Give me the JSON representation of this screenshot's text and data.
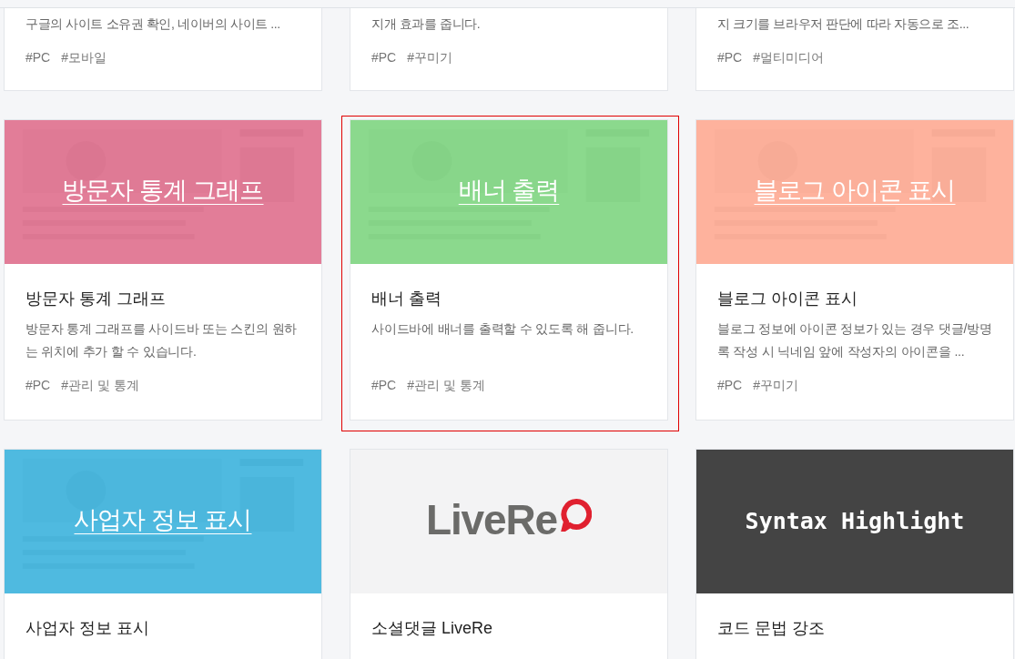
{
  "partial_cards": [
    {
      "description": "구글의 사이트 소유권 확인, 네이버의 사이트 ...",
      "tags": [
        "#PC",
        "#모바일"
      ]
    },
    {
      "description": "지개 효과를 줍니다.",
      "tags": [
        "#PC",
        "#꾸미기"
      ]
    },
    {
      "description": "지 크기를 브라우저 판단에 따라 자동으로 조...",
      "tags": [
        "#PC",
        "#멀티미디어"
      ]
    }
  ],
  "cards": [
    {
      "thumbnail": {
        "kind": "picture",
        "color": "#e0708e",
        "caption": "방문자 통계 그래프"
      },
      "title": "방문자 통계 그래프",
      "description": "방문자 통계 그래프를 사이드바 또는 스킨의 원하는 위치에 추가 할 수 있습니다.",
      "tags": [
        "#PC",
        "#관리 및 통계"
      ],
      "selected": false
    },
    {
      "thumbnail": {
        "kind": "picture",
        "color": "#80d682",
        "caption": "배너 출력"
      },
      "title": "배너 출력",
      "description": "사이드바에 배너를 출력할 수 있도록 해 줍니다.",
      "tags": [
        "#PC",
        "#관리 및 통계"
      ],
      "selected": true
    },
    {
      "thumbnail": {
        "kind": "picture",
        "color": "#ffab94",
        "caption": "블로그 아이콘 표시"
      },
      "title": "블로그 아이콘 표시",
      "description": "블로그 정보에 아이콘 정보가 있는 경우 댓글/방명록 작성 시 닉네임 앞에 작성자의 아이콘을 ...",
      "tags": [
        "#PC",
        "#꾸미기"
      ],
      "selected": false
    },
    {
      "thumbnail": {
        "kind": "picture",
        "color": "#3db4de",
        "caption": "사업자 정보 표시"
      },
      "title": "사업자 정보 표시",
      "selected": false
    },
    {
      "thumbnail": {
        "kind": "logo",
        "color": "#f3f3f4",
        "caption": "LiveRe"
      },
      "title": "소셜댓글 LiveRe",
      "selected": false
    },
    {
      "thumbnail": {
        "kind": "code",
        "color": "#444444",
        "caption": "Syntax Highlight"
      },
      "title": "코드 문법 강조",
      "selected": false
    }
  ]
}
